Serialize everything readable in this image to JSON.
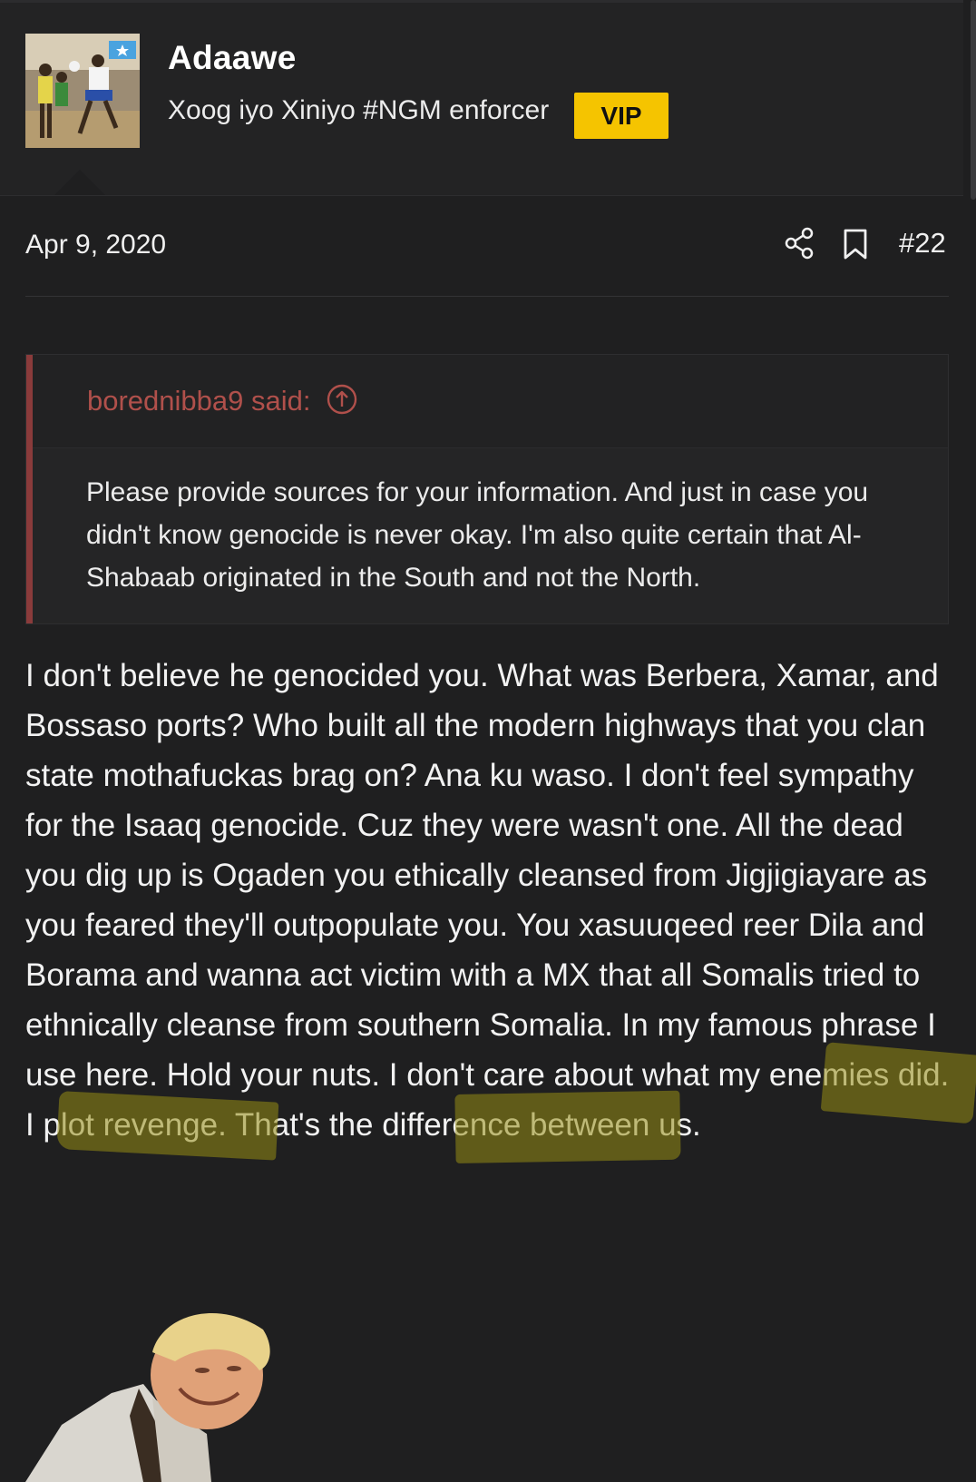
{
  "user": {
    "name": "Adaawe",
    "title": "Xoog iyo Xiniyo #NGM enforcer",
    "badge": "VIP",
    "avatar_alt": "avatar"
  },
  "meta": {
    "date": "Apr 9, 2020",
    "post_number": "#22",
    "share_icon": "share-icon",
    "bookmark_icon": "bookmark-icon"
  },
  "quote": {
    "author": "borednibba9 said:",
    "jump_icon": "arrow-up-circle-icon",
    "text": "Please provide sources for your information. And just in case you didn't know genocide is never okay. I'm also quite certain that Al-Shabaab originated in the South and not the North."
  },
  "post": {
    "body": "I don't believe he genocided you. What was Berbera, Xamar, and Bossaso ports? Who built all the modern highways that you clan state mothafuckas brag on? Ana ku waso. I don't feel sympathy for the Isaaq genocide. Cuz they were wasn't one. All the dead you dig up is Ogaden you ethically cleansed from Jigjigiayare as you feared they'll outpopulate you. You xasuuqeed reer Dila and Borama and wanna act victim with a MX that all Somalis tried to ethnically cleanse from southern Somalia. In my famous phrase I use here. Hold your nuts. I don't care about what my enemies did. I plot revenge. That's the difference between us."
  },
  "colors": {
    "background": "#1f1f20",
    "badge": "#f5c400",
    "quote_accent": "#8a3b3b",
    "quote_author": "#b0504b",
    "highlight": "#96881a"
  }
}
